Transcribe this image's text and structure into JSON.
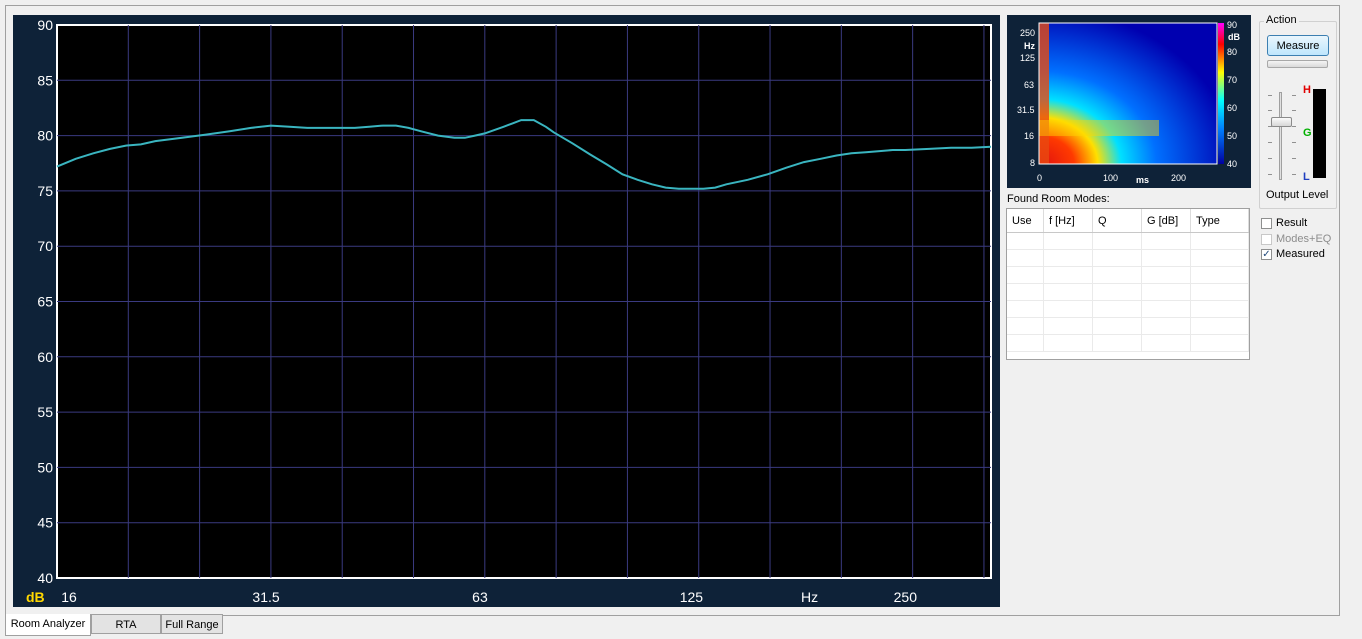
{
  "chart_data": {
    "type": "line",
    "ylabel": "dB",
    "xlabel": "Hz",
    "x_scale": "log",
    "xlim": [
      16,
      330
    ],
    "ylim": [
      40,
      90
    ],
    "yticks": [
      40,
      45,
      50,
      55,
      60,
      65,
      70,
      75,
      80,
      85,
      90
    ],
    "xtick_labels": [
      {
        "value": 16,
        "label": "16"
      },
      {
        "value": 31.5,
        "label": "31.5"
      },
      {
        "value": 63,
        "label": "63"
      },
      {
        "value": 125,
        "label": "125"
      },
      {
        "value": 250,
        "label": "250"
      }
    ],
    "grid": true,
    "series": [
      {
        "color": "#3ab5c0",
        "x": [
          16,
          17,
          18,
          19,
          20,
          21,
          22,
          24,
          26,
          28,
          30,
          32,
          34,
          36,
          38,
          40,
          42,
          44,
          46,
          48,
          50,
          52,
          55,
          58,
          60,
          62,
          64,
          66,
          68,
          70,
          72,
          75,
          78,
          80,
          85,
          90,
          95,
          100,
          105,
          110,
          115,
          120,
          125,
          130,
          135,
          140,
          150,
          160,
          170,
          180,
          190,
          200,
          210,
          220,
          230,
          240,
          250,
          270,
          290,
          310,
          330
        ],
        "y": [
          77.2,
          77.9,
          78.4,
          78.8,
          79.1,
          79.2,
          79.5,
          79.8,
          80.1,
          80.4,
          80.7,
          80.9,
          80.8,
          80.7,
          80.7,
          80.7,
          80.7,
          80.8,
          80.9,
          80.9,
          80.7,
          80.4,
          80.0,
          79.8,
          79.8,
          80.0,
          80.2,
          80.5,
          80.8,
          81.1,
          81.4,
          81.4,
          80.8,
          80.3,
          79.3,
          78.3,
          77.4,
          76.5,
          76.0,
          75.6,
          75.3,
          75.2,
          75.2,
          75.2,
          75.3,
          75.6,
          76.0,
          76.5,
          77.1,
          77.6,
          77.9,
          78.2,
          78.4,
          78.5,
          78.6,
          78.7,
          78.7,
          78.8,
          78.9,
          78.9,
          79.0
        ]
      }
    ]
  },
  "waterfall": {
    "y_unit": "Hz",
    "y_ticks": [
      "250",
      "125",
      "63",
      "31.5",
      "16",
      "8"
    ],
    "x_unit": "ms",
    "x_ticks": [
      "0",
      "100",
      "200"
    ],
    "colorbar_unit": "dB",
    "colorbar_ticks": [
      "90",
      "80",
      "70",
      "60",
      "50",
      "40"
    ]
  },
  "room_modes": {
    "label": "Found Room Modes:",
    "columns": [
      "Use",
      "f [Hz]",
      "Q",
      "G [dB]",
      "Type"
    ],
    "empty_rows": 7
  },
  "action": {
    "label": "Action",
    "measure_button": "Measure",
    "output_level_label": "Output Level",
    "level_marks": {
      "high": "H",
      "good": "G",
      "low": "L"
    }
  },
  "options": [
    {
      "label": "Result",
      "checked": false,
      "disabled": false
    },
    {
      "label": "Modes+EQ",
      "checked": false,
      "disabled": true
    },
    {
      "label": "Measured",
      "checked": true,
      "disabled": false
    }
  ],
  "tabs": [
    {
      "label": "Room Analyzer",
      "active": true
    },
    {
      "label": "RTA",
      "active": false
    },
    {
      "label": "Full Range",
      "active": false
    }
  ],
  "colors": {
    "chart_bg": "#000000",
    "chart_frame": "#0e2238",
    "grid": "#3a3a80",
    "curve": "#3ab5c0",
    "db_label": "#ffd800"
  }
}
